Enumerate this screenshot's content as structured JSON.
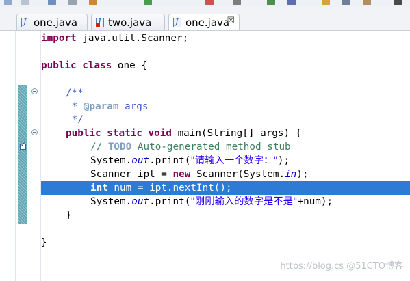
{
  "tabs": [
    {
      "label": "one.java",
      "icon": "java-file-icon",
      "error": false,
      "active": false
    },
    {
      "label": "two.java",
      "icon": "java-file-error-icon",
      "error": true,
      "active": false
    },
    {
      "label": "one.java",
      "icon": "java-file-icon",
      "error": false,
      "active": true,
      "close": "☒"
    }
  ],
  "code": {
    "l1": {
      "kw": "import",
      "rest": " java.util.Scanner;"
    },
    "l3": {
      "kw1": "public",
      "kw2": "class",
      "rest": " one {"
    },
    "l5": {
      "text": "/**"
    },
    "l6": {
      "pre": " * ",
      "tag": "@param",
      "post": " args"
    },
    "l7": {
      "text": " */"
    },
    "l8": {
      "kw1": "public",
      "kw2": "static",
      "kw3": "void",
      "rest": " main(String[] args) {"
    },
    "l9": {
      "pre": "// ",
      "todo": "TODO",
      "post": " Auto-generated method stub"
    },
    "l10": {
      "a": "System.",
      "field": "out",
      "b": ".print(",
      "str1": "\"请输入一个数字：\"",
      "c": ");"
    },
    "l11": {
      "a": "Scanner ipt = ",
      "kw": "new",
      "b": " Scanner(System.",
      "field": "in",
      "c": ");"
    },
    "l12": {
      "kw": "int",
      "rest": " num = ipt.nextInt();"
    },
    "l13": {
      "a": "System.",
      "field": "out",
      "b": ".print(",
      "str1": "\"刚刚输入的数字是不是\"",
      "c": "+num);"
    },
    "l14": {
      "text": "}"
    },
    "l16": {
      "text": "}"
    }
  },
  "watermark": "https://blog.cs @51CTO博客",
  "colors": {
    "keyword": "#7f0055",
    "string": "#2a00ff",
    "javadoc": "#3f5fbf",
    "comment": "#3f7f5f",
    "static_field": "#0000c0",
    "selection": "#2e7bd6"
  }
}
